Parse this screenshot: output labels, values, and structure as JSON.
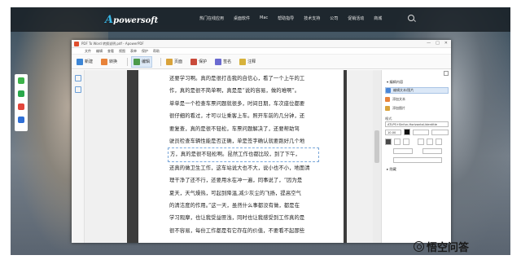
{
  "site": {
    "logo_letter": "A",
    "logo_text": "powersoft",
    "nav": [
      "热门在线应用",
      "桌面软件",
      "Mac",
      "帮助指导",
      "技术支持",
      "公司",
      "促销活动",
      "商城"
    ]
  },
  "app": {
    "window_title": "PDF To Word 转换说明.pdf - ApowerPDF",
    "menu": [
      "文件",
      "编辑",
      "查看",
      "视图",
      "表单",
      "保护",
      "帮助"
    ],
    "toolbar": [
      {
        "label": "新建",
        "icon": "new-file-icon",
        "color": "#3d86d6"
      },
      {
        "label": "转换",
        "icon": "convert-icon",
        "color": "#e8833a"
      },
      {
        "label": "编辑",
        "icon": "edit-icon",
        "color": "#4a9a4a",
        "active": true
      },
      {
        "label": "页面",
        "icon": "page-icon",
        "color": "#d9a33b"
      },
      {
        "label": "保护",
        "icon": "shield-icon",
        "color": "#c94a3a"
      },
      {
        "label": "签名",
        "icon": "sign-icon",
        "color": "#6a6ad0"
      },
      {
        "label": "注释",
        "icon": "comment-icon",
        "color": "#d7b23c"
      }
    ],
    "window_controls": [
      "—",
      "□",
      "✕"
    ]
  },
  "document": {
    "lines": [
      "还要学习啊。真的是很打击我的自信心，看了一个上午的工",
      "作，真的是很不简单啊，真是是“说的容易，做的难啊”。",
      "单单是一个检查车票问题就很多，时间日期，车次座位都要",
      "很仔细的看过，才可以让乘客上车。照开车前的几分钟，还",
      "要复查，真的是很不轻松，车票问题解决了，还要帮助驾",
      "驶员检查车辆性能是否正确，单是签字确认就要跑好几个地",
      "方，真的是很不轻松啊。昆然工作也都比较，到了下午，",
      "还真的做卫生工作，这车站说大也不大，说小也不小，地面清",
      "理干净了还不行，还要用水在冲一遍，同事说了，“因为是",
      "夏天，天气燥热，可起到降温,减少灰尘的飞扬，提高空气",
      "的清洁度的作用。”这一天，虽然什么事都没有做，都是在",
      "学习观摩，也让我受益匪浅，同时也让我感受到工作真的是",
      "很不容易，每份工作都是有它存在的价值，不要看不起那些"
    ],
    "selected_line_index": 6
  },
  "panel": {
    "section_edit": "编辑内容",
    "items": [
      "编辑文本/图片",
      "添加文本",
      "添加图片"
    ],
    "format_title": "格式",
    "font_name": "ATLPS+Sinfun-Horizontal-ldentitie",
    "font_size": "10.00",
    "section_extra": "隐藏"
  },
  "watermark": {
    "text": "悟空问答"
  },
  "colors": {
    "accent": "#38b7e6",
    "selection": "#dbe8f7",
    "nav_bg": "#192026"
  }
}
